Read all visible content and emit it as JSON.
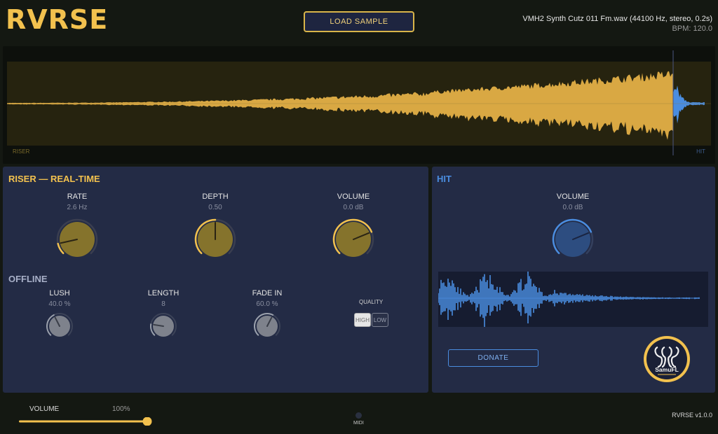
{
  "app": {
    "title": "RVRSE",
    "load_label": "LOAD SAMPLE",
    "file_info": "VMH2 Synth Cutz 011 Fm.wav (44100 Hz, stereo, 0.2s)",
    "bpm": "BPM: 120.0",
    "version": "RVRSE v1.0.0"
  },
  "waveform": {
    "riser_label": "RISER",
    "hit_label": "HIT",
    "colors": {
      "riser": "#d9a843",
      "hit": "#4a8de0",
      "bg": "#26230f"
    }
  },
  "riser": {
    "title": "RISER — REAL-TIME",
    "knobs": [
      {
        "label": "RATE",
        "value": "2.6 Hz",
        "level": 0.12
      },
      {
        "label": "DEPTH",
        "value": "0.50",
        "level": 0.5
      },
      {
        "label": "VOLUME",
        "value": "0.0 dB",
        "level": 0.75
      }
    ],
    "offline_title": "OFFLINE",
    "offline_knobs": [
      {
        "label": "LUSH",
        "value": "40.0 %",
        "level": 0.4
      },
      {
        "label": "LENGTH",
        "value": "8",
        "level": 0.2
      },
      {
        "label": "FADE IN",
        "value": "60.0 %",
        "level": 0.6
      }
    ],
    "quality": {
      "label": "QUALITY",
      "high": "HIGH",
      "low": "LOW",
      "selected": "HIGH"
    }
  },
  "hit": {
    "title": "HIT",
    "volume": {
      "label": "VOLUME",
      "value": "0.0 dB",
      "level": 0.75
    },
    "donate_label": "DONATE",
    "logo_text": "SamuFL"
  },
  "footer": {
    "volume_label": "VOLUME",
    "volume_value": "100%",
    "volume_level": 1.0,
    "midi_label": "MIDI"
  },
  "colors": {
    "accent": "#f2c14e",
    "hit_blue": "#4a8de0",
    "panel": "#232b45",
    "background": "#141812"
  }
}
